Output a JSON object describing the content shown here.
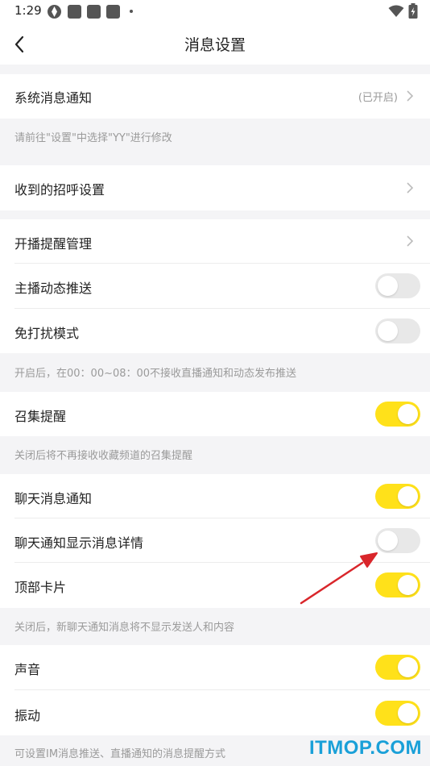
{
  "status_bar": {
    "time": "1:29"
  },
  "header": {
    "title": "消息设置"
  },
  "rows": {
    "system_notification": {
      "label": "系统消息通知",
      "status": "(已开启)"
    },
    "greeting_settings": {
      "label": "收到的招呼设置"
    },
    "live_reminder": {
      "label": "开播提醒管理"
    },
    "anchor_push": {
      "label": "主播动态推送",
      "toggle": false
    },
    "dnd_mode": {
      "label": "免打扰模式",
      "toggle": false
    },
    "gather_reminder": {
      "label": "召集提醒",
      "toggle": true
    },
    "chat_notification": {
      "label": "聊天消息通知",
      "toggle": true
    },
    "chat_detail": {
      "label": "聊天通知显示消息详情",
      "toggle": false
    },
    "top_card": {
      "label": "顶部卡片",
      "toggle": true
    },
    "sound": {
      "label": "声音",
      "toggle": true
    },
    "vibrate": {
      "label": "振动",
      "toggle": true
    }
  },
  "hints": {
    "system": "请前往\"设置\"中选择\"YY\"进行修改",
    "dnd": "开启后，在00：00~08：00不接收直播通知和动态发布推送",
    "gather": "关闭后将不再接收收藏频道的召集提醒",
    "chat": "关闭后，新聊天通知消息将不显示发送人和内容",
    "im": "可设置IM消息推送、直播通知的消息提醒方式"
  },
  "watermark": "ITMOP.COM",
  "colors": {
    "toggle_on": "#ffe11a",
    "toggle_off": "#e8e8e8",
    "background": "#f4f4f6",
    "arrow": "#d9262b",
    "watermark": "#1aa0d8"
  }
}
